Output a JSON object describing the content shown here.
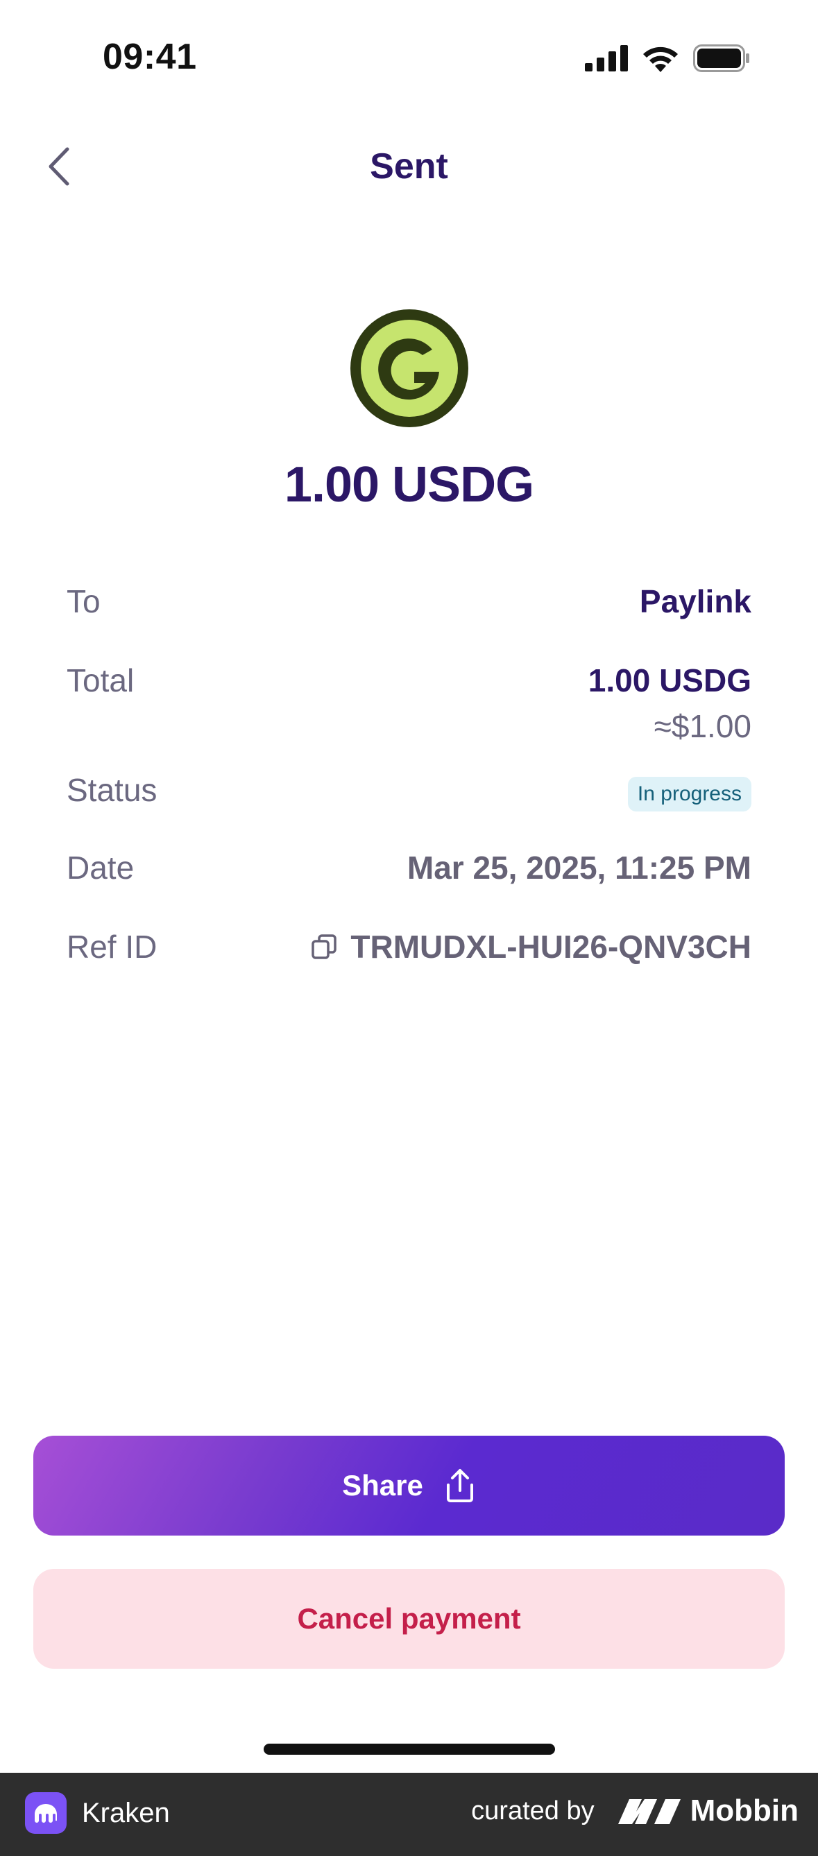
{
  "status_bar": {
    "time": "09:41"
  },
  "header": {
    "title": "Sent"
  },
  "asset": {
    "amount": "1.00 USDG",
    "logo_color": "#c6e46e",
    "logo_ring_color": "#2e3a12"
  },
  "details": {
    "to": {
      "label": "To",
      "value": "Paylink"
    },
    "total": {
      "label": "Total",
      "value": "1.00 USDG",
      "sub": "≈$1.00"
    },
    "status": {
      "label": "Status",
      "value": "In progress"
    },
    "date": {
      "label": "Date",
      "value": "Mar 25, 2025, 11:25 PM"
    },
    "ref": {
      "label": "Ref ID",
      "value": "TRMUDXL-HUI26-QNV3CH"
    }
  },
  "actions": {
    "share_label": "Share",
    "cancel_label": "Cancel payment"
  },
  "footer": {
    "app_name": "Kraken",
    "curated_by": "curated by",
    "brand": "Mobbin"
  },
  "colors": {
    "primary_text": "#2b1766",
    "accent": "#5b2ad0",
    "danger": "#c41f4a"
  }
}
